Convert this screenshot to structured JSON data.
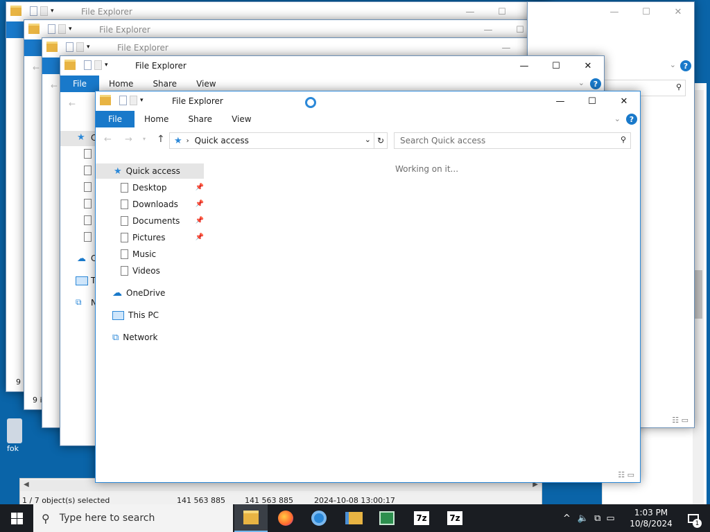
{
  "window": {
    "title": "File Explorer",
    "tabs": {
      "file": "File",
      "home": "Home",
      "share": "Share",
      "view": "View"
    },
    "controls": {
      "minimize": "—",
      "maximize": "☐",
      "close": "✕"
    },
    "address": {
      "path": "Quick access"
    },
    "search": {
      "placeholder": "Search Quick access"
    },
    "status_message": "Working on it..."
  },
  "background_windows": {
    "letters": {
      "c": "C",
      "t": "T",
      "n": "N"
    },
    "status_fragment": "9 i"
  },
  "nav": {
    "quick_access": "Quick access",
    "items": [
      {
        "label": "Desktop",
        "pinned": true
      },
      {
        "label": "Downloads",
        "pinned": true
      },
      {
        "label": "Documents",
        "pinned": true
      },
      {
        "label": "Pictures",
        "pinned": true
      },
      {
        "label": "Music",
        "pinned": false
      },
      {
        "label": "Videos",
        "pinned": false
      }
    ],
    "onedrive": "OneDrive",
    "this_pc": "This PC",
    "network": "Network"
  },
  "back_statusbar": {
    "selection": "1 / 7 object(s) selected",
    "size1": "141 563 885",
    "size2": "141 563 885",
    "datetime": "2024-10-08 13:00:17"
  },
  "desktop": {
    "icon_label": "fok"
  },
  "taskbar": {
    "search_placeholder": "Type here to search",
    "time": "1:03 PM",
    "date": "10/8/2024",
    "notification_count": "1",
    "apps": [
      "file-explorer",
      "firefox",
      "chrome",
      "folder-app",
      "spreadsheet",
      "7zip",
      "7zip-2"
    ]
  },
  "colors": {
    "accent": "#1979ca",
    "taskbar": "#1a1d22",
    "desktop": "#0a64a8"
  }
}
